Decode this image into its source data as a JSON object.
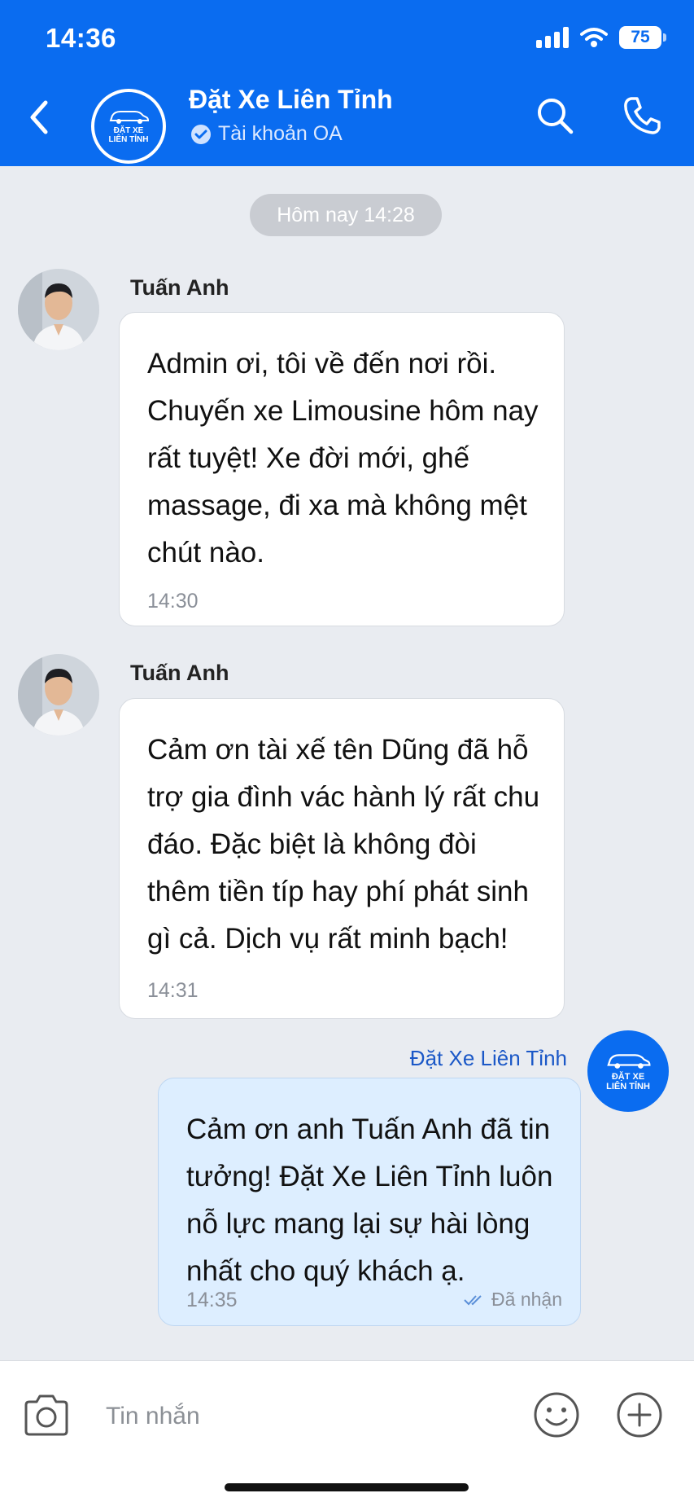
{
  "status_bar": {
    "time": "14:36",
    "battery": "75"
  },
  "header": {
    "title": "Đặt Xe Liên Tỉnh",
    "subtitle": "Tài khoản OA",
    "logo_text_1": "ĐẶT XE",
    "logo_text_2": "LIÊN TỈNH"
  },
  "chat": {
    "date_label": "Hôm nay 14:28",
    "messages": [
      {
        "sender": "Tuấn Anh",
        "text": "Admin ơi, tôi về đến nơi rồi. Chuyến xe Limousine hôm nay rất tuyệt! Xe đời mới, ghế massage, đi xa mà không mệt chút nào.",
        "time": "14:30"
      },
      {
        "sender": "Tuấn Anh",
        "text": "Cảm ơn tài xế tên Dũng đã hỗ trợ gia đình vác hành lý rất chu đáo. Đặc biệt là không đòi thêm tiền típ hay phí phát sinh gì cả. Dịch vụ rất minh bạch!",
        "time": "14:31"
      },
      {
        "sender": "Đặt Xe Liên Tỉnh",
        "text": "Cảm ơn anh Tuấn Anh đã tin tưởng! Đặt Xe Liên Tỉnh luôn nỗ lực mang lại sự hài lòng nhất cho quý khách ạ.",
        "time": "14:35",
        "status": "Đã nhận"
      }
    ]
  },
  "input": {
    "placeholder": "Tin nhắn"
  },
  "colors": {
    "brand": "#0a6cf0",
    "outgoing_bubble": "#ddeeff",
    "background": "#e9ecf1"
  }
}
